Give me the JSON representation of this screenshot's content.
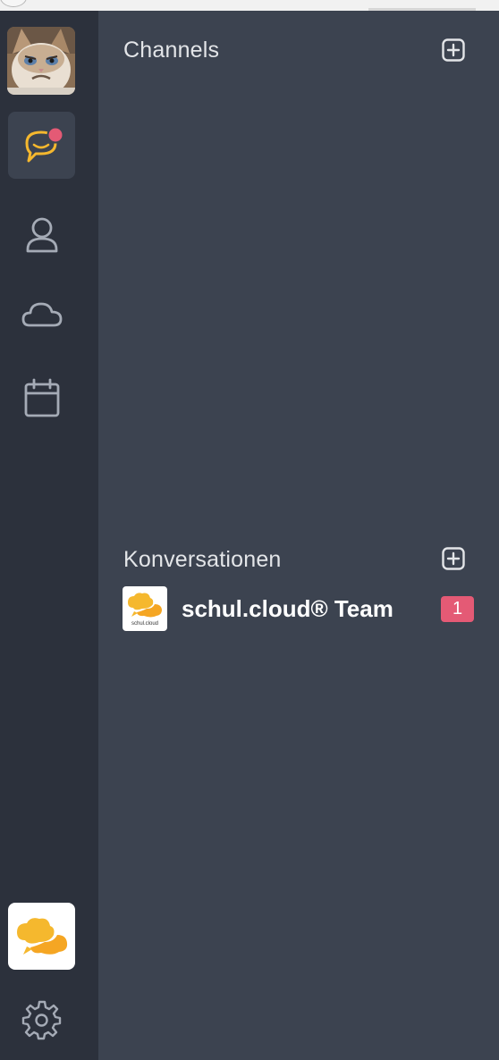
{
  "sidebar": {
    "items": [
      {
        "name": "chat",
        "icon": "chat-bubble-icon",
        "active": true,
        "has_notification": true
      },
      {
        "name": "contacts",
        "icon": "user-icon",
        "active": false
      },
      {
        "name": "cloud",
        "icon": "cloud-icon",
        "active": false
      },
      {
        "name": "calendar",
        "icon": "calendar-icon",
        "active": false
      }
    ],
    "bottom": [
      {
        "name": "app-logo",
        "icon": "schul-cloud-logo-icon"
      },
      {
        "name": "settings",
        "icon": "gear-icon"
      }
    ]
  },
  "channels": {
    "title": "Channels",
    "add_icon": "plus-square-icon"
  },
  "conversations": {
    "title": "Konversationen",
    "add_icon": "plus-square-icon",
    "items": [
      {
        "name": "schul.cloud® Team",
        "unread": "1",
        "avatar_icon": "schul-cloud-logo-icon"
      }
    ]
  },
  "colors": {
    "rail_bg": "#2c313c",
    "panel_bg": "#3c4350",
    "accent": "#f5b82e",
    "badge": "#e45a75"
  }
}
